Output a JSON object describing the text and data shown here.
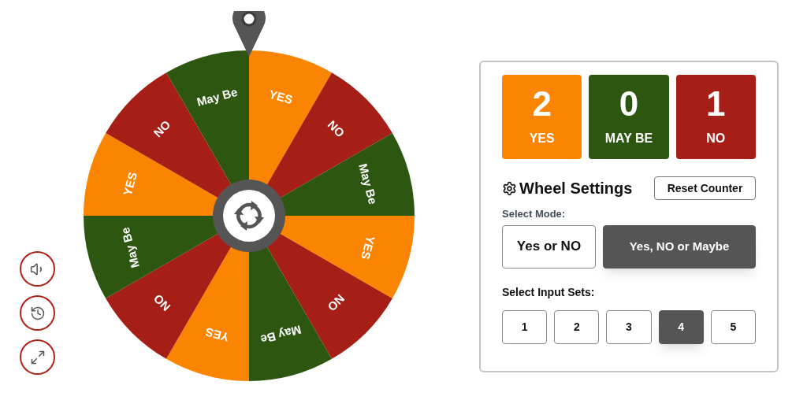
{
  "wheel": {
    "segments": [
      {
        "label": "YES",
        "color": "#fb8500"
      },
      {
        "label": "NO",
        "color": "#a51f16"
      },
      {
        "label": "May Be",
        "color": "#2d5711"
      },
      {
        "label": "YES",
        "color": "#fb8500"
      },
      {
        "label": "NO",
        "color": "#a51f16"
      },
      {
        "label": "May Be",
        "color": "#2d5711"
      },
      {
        "label": "YES",
        "color": "#fb8500"
      },
      {
        "label": "NO",
        "color": "#a51f16"
      },
      {
        "label": "May Be",
        "color": "#2d5711"
      },
      {
        "label": "YES",
        "color": "#fb8500"
      },
      {
        "label": "NO",
        "color": "#a51f16"
      },
      {
        "label": "May Be",
        "color": "#2d5711"
      }
    ]
  },
  "side_buttons": [
    {
      "kind": "sound"
    },
    {
      "kind": "history"
    },
    {
      "kind": "fullscreen"
    }
  ],
  "counters": [
    {
      "count": "2",
      "label": "YES",
      "color": "#fb8500"
    },
    {
      "count": "0",
      "label": "MAY BE",
      "color": "#2d5711"
    },
    {
      "count": "1",
      "label": "NO",
      "color": "#a51f16"
    }
  ],
  "settings": {
    "title": "Wheel Settings",
    "reset_button": "Reset Counter",
    "mode_label": "Select Mode:",
    "modes": [
      {
        "label": "Yes or NO",
        "selected": false
      },
      {
        "label": "Yes, NO or Maybe",
        "selected": true
      }
    ],
    "input_sets_label": "Select Input Sets:",
    "input_sets": [
      {
        "label": "1",
        "selected": false
      },
      {
        "label": "2",
        "selected": false
      },
      {
        "label": "3",
        "selected": false
      },
      {
        "label": "4",
        "selected": true
      },
      {
        "label": "5",
        "selected": false
      }
    ]
  }
}
